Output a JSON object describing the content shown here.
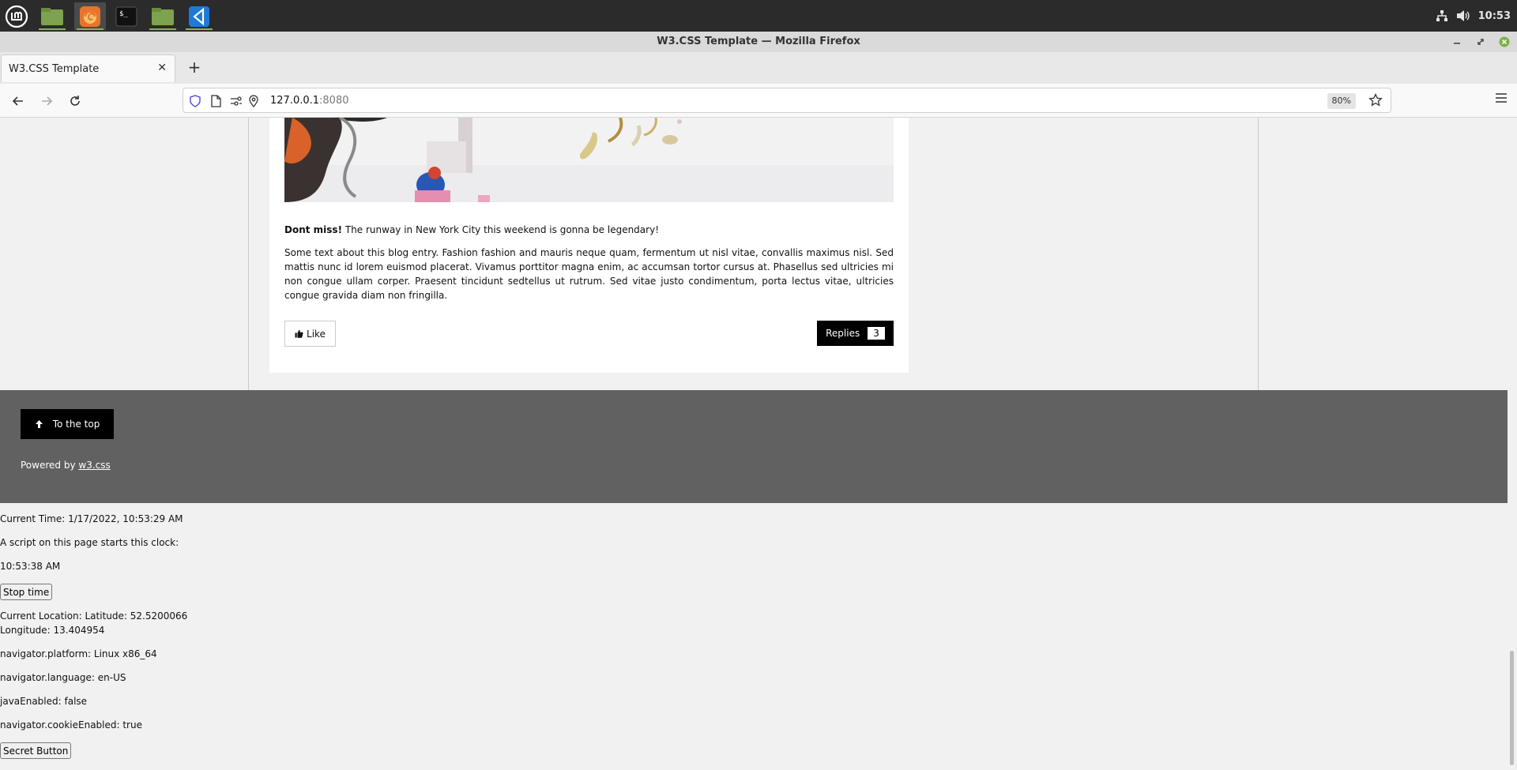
{
  "taskbar": {
    "apps": [
      {
        "name": "mint-menu-icon"
      },
      {
        "name": "files-icon"
      },
      {
        "name": "firefox-icon"
      },
      {
        "name": "terminal-icon"
      },
      {
        "name": "folder-icon"
      },
      {
        "name": "vscode-icon"
      }
    ],
    "clock": "10:53"
  },
  "window": {
    "title": "W3.CSS Template — Mozilla Firefox"
  },
  "browser": {
    "tab_title": "W3.CSS Template",
    "tab_close": "✕",
    "new_tab": "+",
    "url_host": "127.0.0.1",
    "url_port": ":8080",
    "zoom": "80%"
  },
  "page": {
    "blog": {
      "lead_bold": "Dont miss!",
      "lead_rest": " The runway in New York City this weekend is gonna be legendary!",
      "body": "Some text about this blog entry. Fashion fashion and mauris neque quam, fermentum ut nisl vitae, convallis maximus nisl. Sed mattis nunc id lorem euismod placerat. Vivamus porttitor magna enim, ac accumsan tortor cursus at. Phasellus sed ultricies mi non congue ullam corper. Praesent tincidunt sedtellus ut rutrum. Sed vitae justo condimentum, porta lectus vitae, ultricies congue gravida diam non fringilla.",
      "like_label": "Like",
      "replies_label": "Replies",
      "replies_count": "3"
    },
    "footer": {
      "top_label": "To the top",
      "powered_prefix": "Powered by ",
      "powered_link": "w3.css"
    },
    "info": {
      "current_time": "Current Time: 1/17/2022, 10:53:29 AM",
      "clock_intro": "A script on this page starts this clock:",
      "clock_value": "10:53:38 AM",
      "stop_label": "Stop time",
      "latitude": "Current Location: Latitude: 52.5200066",
      "longitude": "Longitude: 13.404954",
      "platform": "navigator.platform: Linux x86_64",
      "language": "navigator.language: en-US",
      "java": "javaEnabled: false",
      "cookies": "navigator.cookieEnabled: true",
      "secret_label": "Secret Button"
    }
  },
  "colors": {
    "footer_bg": "#616161",
    "page_bg": "#f1f1f1",
    "taskbar_bg": "#2b2b2b",
    "accent_green": "#8ab25a"
  }
}
